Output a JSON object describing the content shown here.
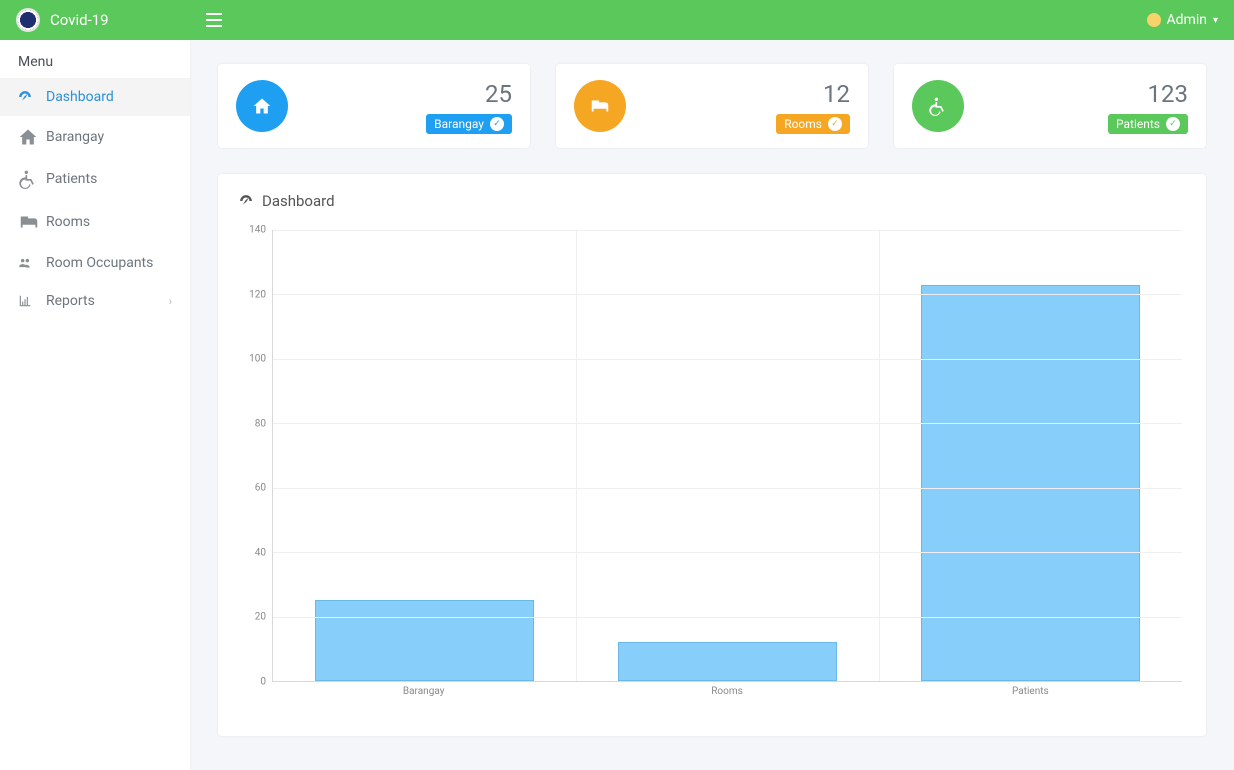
{
  "brand": {
    "title": "Covid-19"
  },
  "user": {
    "name": "Admin"
  },
  "sidebar": {
    "header": "Menu",
    "items": [
      {
        "icon": "dashboard-icon",
        "label": "Dashboard",
        "active": true,
        "has_sub": false
      },
      {
        "icon": "home-icon",
        "label": "Barangay",
        "active": false,
        "has_sub": false
      },
      {
        "icon": "wheelchair-icon",
        "label": "Patients",
        "active": false,
        "has_sub": false
      },
      {
        "icon": "bed-icon",
        "label": "Rooms",
        "active": false,
        "has_sub": false
      },
      {
        "icon": "users-icon",
        "label": "Room Occupants",
        "active": false,
        "has_sub": false
      },
      {
        "icon": "chart-icon",
        "label": "Reports",
        "active": false,
        "has_sub": true
      }
    ]
  },
  "cards": [
    {
      "icon": "home-icon",
      "color": "blue",
      "value": "25",
      "label": "Barangay"
    },
    {
      "icon": "bed-icon",
      "color": "orange",
      "value": "12",
      "label": "Rooms"
    },
    {
      "icon": "wheelchair-icon",
      "color": "green",
      "value": "123",
      "label": "Patients"
    }
  ],
  "panel": {
    "title": "Dashboard"
  },
  "chart_data": {
    "type": "bar",
    "categories": [
      "Barangay",
      "Rooms",
      "Patients"
    ],
    "values": [
      25,
      12,
      123
    ],
    "title": "",
    "xlabel": "",
    "ylabel": "",
    "ylim": [
      0,
      140
    ],
    "y_ticks": [
      0,
      20,
      40,
      60,
      80,
      100,
      120,
      140
    ]
  }
}
